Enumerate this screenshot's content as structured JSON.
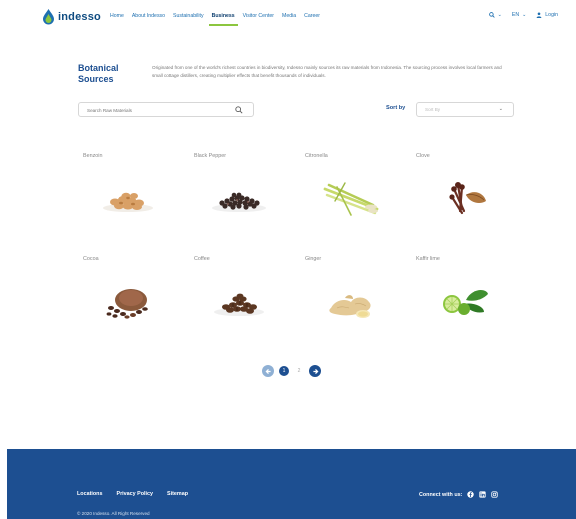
{
  "header": {
    "logo_text": "indesso",
    "nav": [
      "Home",
      "About Indesso",
      "Sustainability",
      "Business",
      "Visitor Center",
      "Media",
      "Career"
    ],
    "active_nav": "Business",
    "language": "EN",
    "login_label": "Login"
  },
  "intro": {
    "title": "Botanical Sources",
    "text": "Originated from one of the world's richest countries in biodiversity, Indesso mainly sources its raw materials from Indonesia. The sourcing process involves local farmers and small cottage distillers, creating multiplier effects that benefit thousands of individuals."
  },
  "search": {
    "placeholder": "Search Raw Materials"
  },
  "sort": {
    "label": "Sort by",
    "placeholder": "Sort By"
  },
  "products": [
    {
      "name": "Benzoin",
      "icon": "benzoin-image"
    },
    {
      "name": "Black Pepper",
      "icon": "black-pepper-image"
    },
    {
      "name": "Citronella",
      "icon": "citronella-image"
    },
    {
      "name": "Clove",
      "icon": "clove-image"
    },
    {
      "name": "Cocoa",
      "icon": "cocoa-image"
    },
    {
      "name": "Coffee",
      "icon": "coffee-image"
    },
    {
      "name": "Ginger",
      "icon": "ginger-image"
    },
    {
      "name": "Kaffir lime",
      "icon": "kaffir-lime-image"
    }
  ],
  "pagination": {
    "current": "1",
    "next_page": "2"
  },
  "footer": {
    "links": [
      "Locations",
      "Privacy Policy",
      "Sitemap"
    ],
    "connect_label": "Connect with us:",
    "copyright": "© 2020 Indesso. All Right Reserved"
  },
  "colors": {
    "brand_blue": "#1d4f91",
    "accent_green": "#8cc63f",
    "footer_bg": "#1d4f91"
  }
}
